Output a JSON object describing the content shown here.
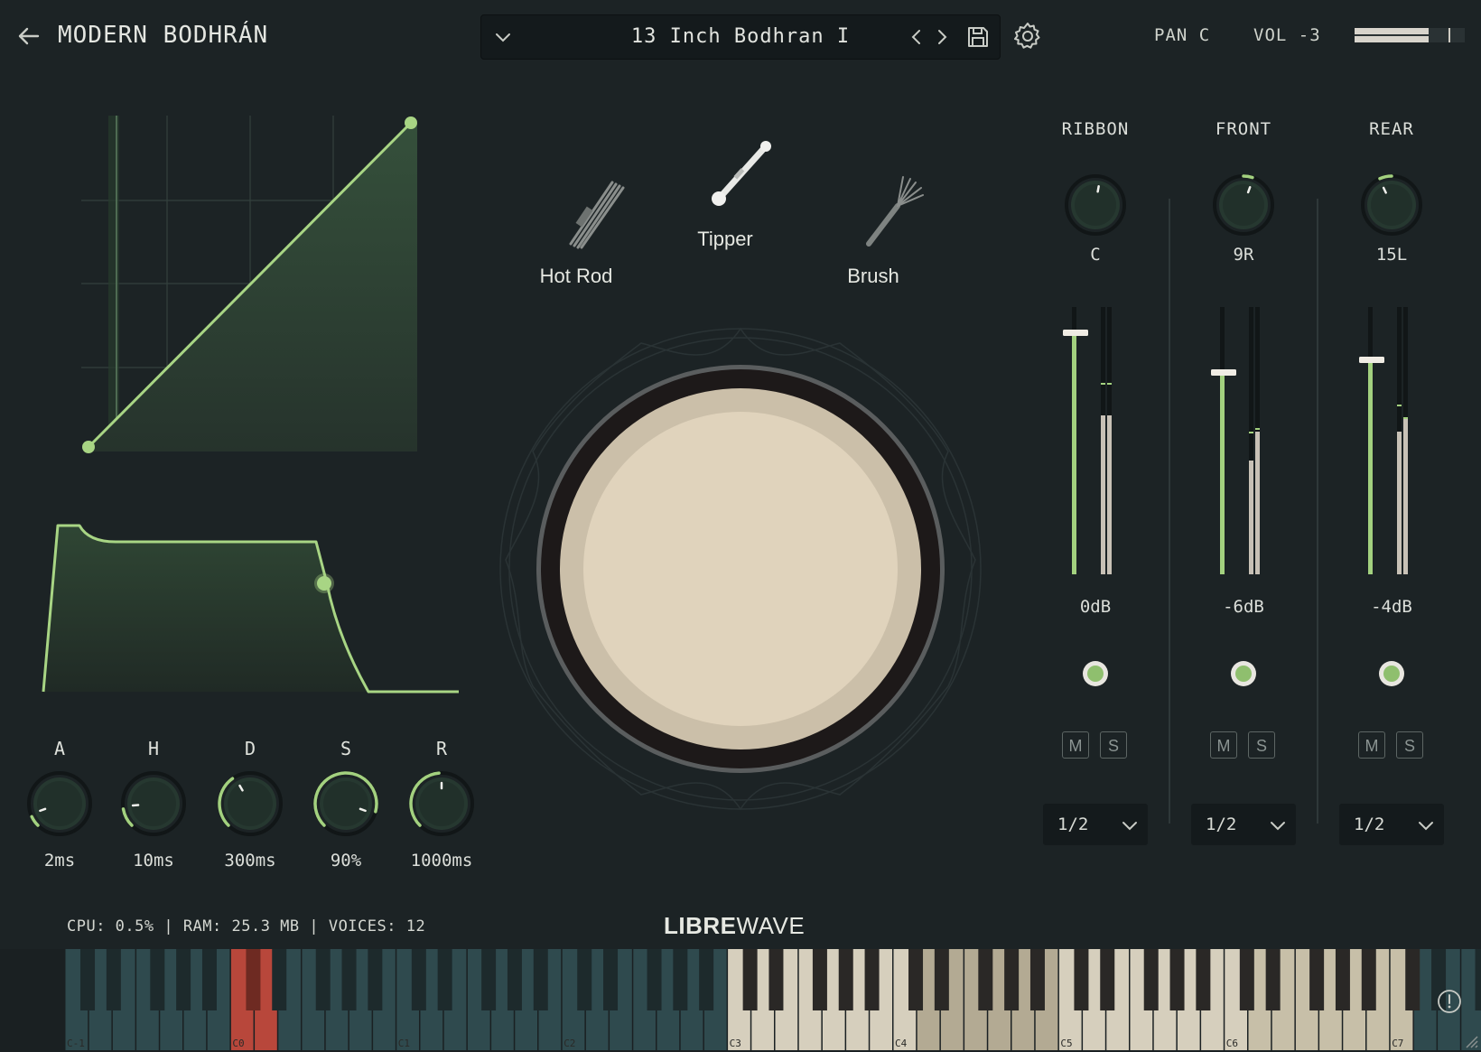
{
  "header": {
    "title": "MODERN BODHRÁN",
    "preset_name": "13 Inch Bodhran I",
    "pan": "PAN C",
    "vol": "VOL -3"
  },
  "mallets": [
    {
      "label": "Hot Rod",
      "selected": false
    },
    {
      "label": "Tipper",
      "selected": true
    },
    {
      "label": "Brush",
      "selected": false
    }
  ],
  "channels": [
    {
      "name": "RIBBON",
      "pan": "C",
      "level": "0dB",
      "output": "1/2",
      "mute": "M",
      "solo": "S"
    },
    {
      "name": "FRONT",
      "pan": "9R",
      "level": "-6dB",
      "output": "1/2",
      "mute": "M",
      "solo": "S"
    },
    {
      "name": "REAR",
      "pan": "15L",
      "level": "-4dB",
      "output": "1/2",
      "mute": "M",
      "solo": "S"
    }
  ],
  "envelope": [
    {
      "label": "A",
      "value": "2ms"
    },
    {
      "label": "H",
      "value": "10ms"
    },
    {
      "label": "D",
      "value": "300ms"
    },
    {
      "label": "S",
      "value": "90%"
    },
    {
      "label": "R",
      "value": "1000ms"
    }
  ],
  "status": "CPU: 0.5% | RAM: 25.3 MB | VOICES: 12",
  "brand": {
    "bold": "LIBRE",
    "light": "WAVE"
  },
  "keyboard": {
    "octave_labels": [
      "C-1",
      "C0",
      "C1",
      "C2",
      "C3",
      "C4",
      "C5",
      "C6",
      "C7"
    ]
  },
  "colors": {
    "background": "#1c2325",
    "accent": "#a3d17f",
    "keyswitch": "#b8473b",
    "drum_head": "#e0d3bc"
  }
}
